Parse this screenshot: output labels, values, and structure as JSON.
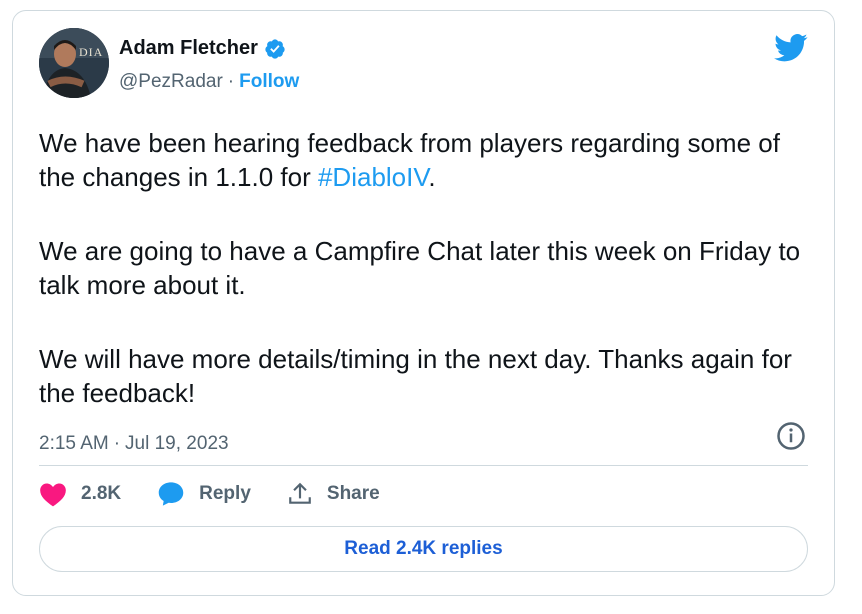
{
  "author": {
    "display_name": "Adam Fletcher",
    "handle": "@PezRadar",
    "separator": "·",
    "follow_label": "Follow",
    "verified": true,
    "avatar_icon": "avatar-photo"
  },
  "brand": {
    "icon": "twitter-bird-icon",
    "color": "#1d9bf0"
  },
  "tweet": {
    "paragraph1_before": "We have been hearing feedback from players regarding some of the changes in 1.1.0 for ",
    "hashtag": "#DiabloIV",
    "paragraph1_after": ".",
    "paragraph2": "We are going to have a Campfire Chat later this week on Friday to talk more about it.",
    "paragraph3": "We will have more details/timing in the next day. Thanks again for the feedback!"
  },
  "meta": {
    "time": "2:15 AM",
    "separator": "·",
    "date": "Jul 19, 2023"
  },
  "actions": {
    "like_count": "2.8K",
    "reply_label": "Reply",
    "share_label": "Share"
  },
  "replies_button": {
    "label": "Read 2.4K replies"
  },
  "colors": {
    "accent": "#1d9bf0",
    "like": "#f91880",
    "text": "#0f1419",
    "muted": "#536471",
    "border": "#cfd9de"
  }
}
